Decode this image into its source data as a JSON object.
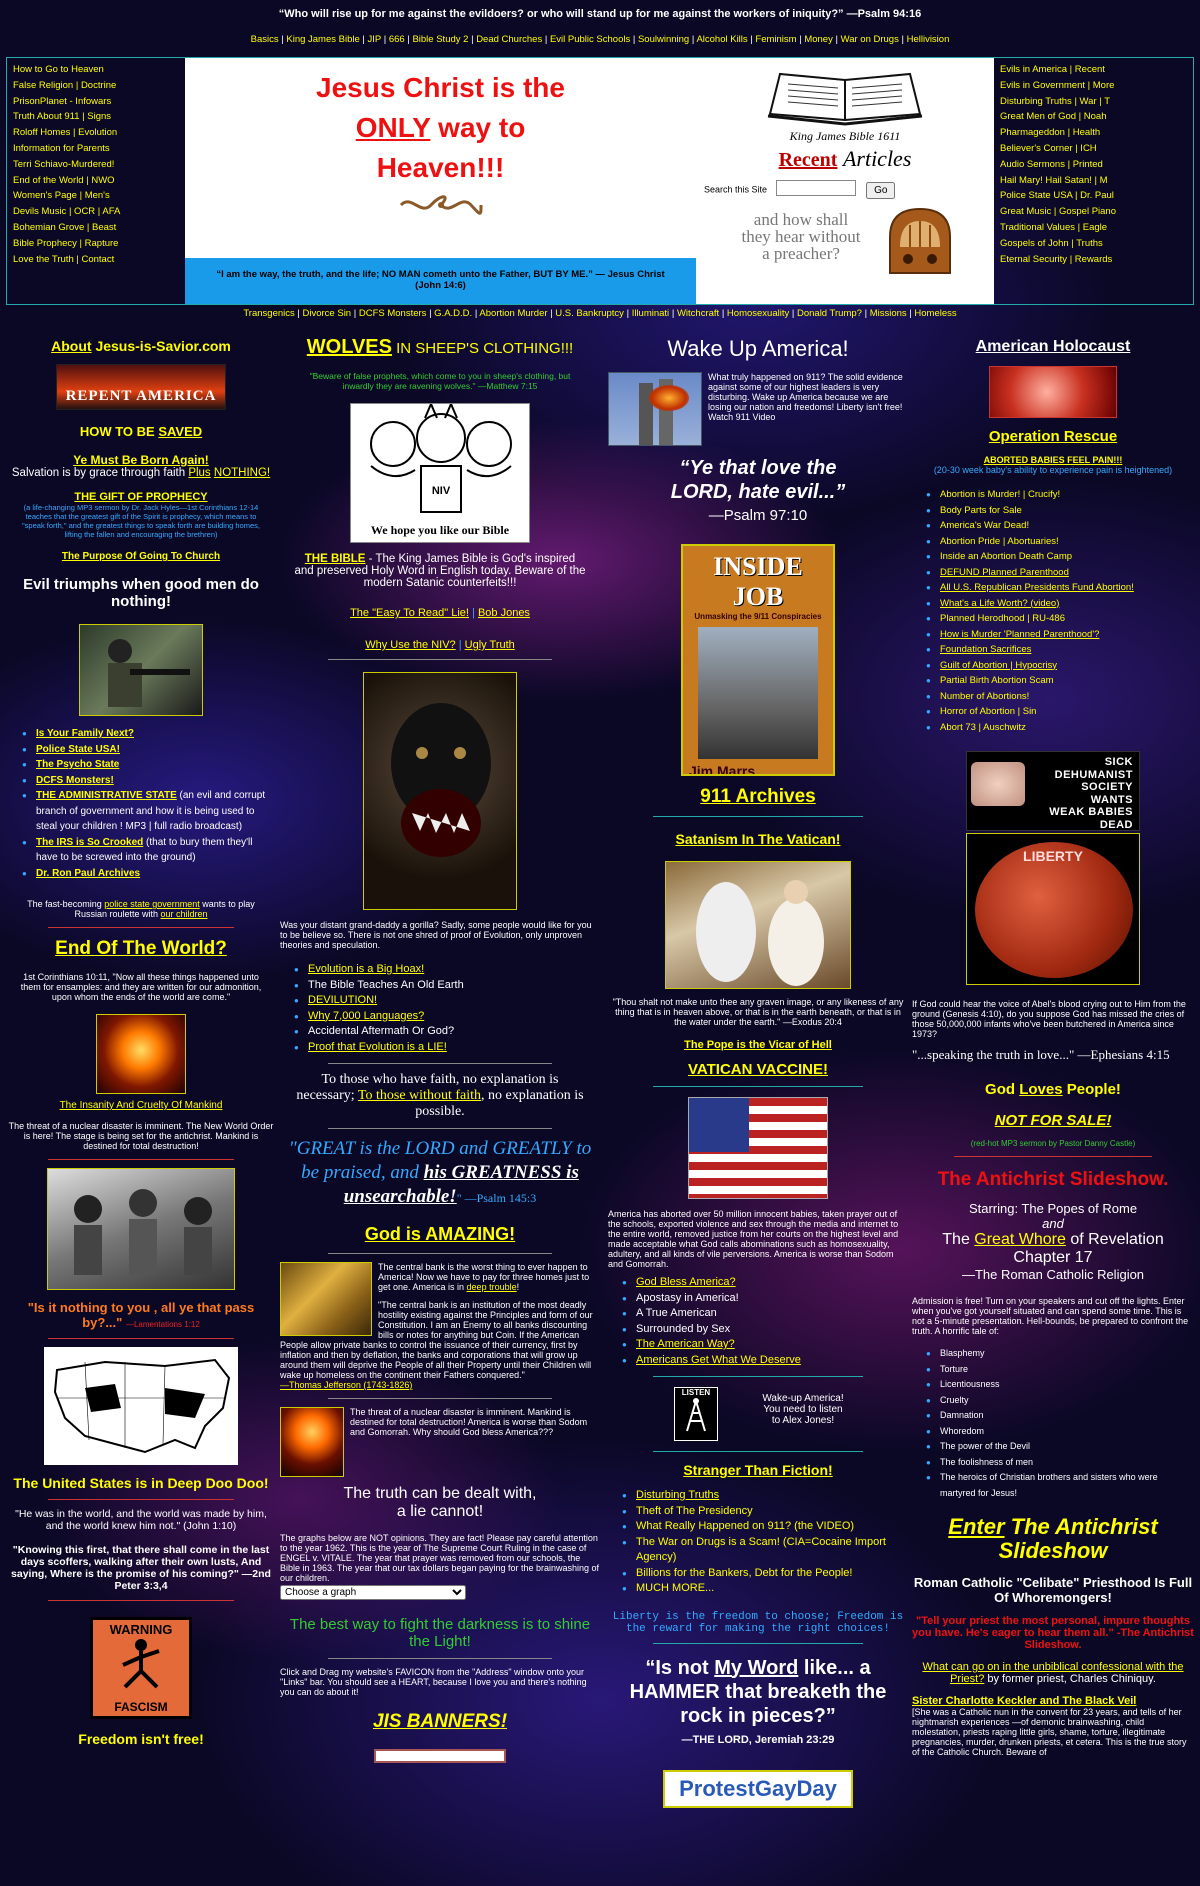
{
  "top": {
    "quote": "“Who will rise up for me against the evildoers? or who will stand up for me against the workers of iniquity?” —Psalm 94:16",
    "nav": [
      "Basics",
      "King James Bible",
      "JIP",
      "666",
      "Bible Study 2",
      "Dead Churches",
      "Evil Public Schools",
      "Soulwinning",
      "Alcohol Kills",
      "Feminism",
      "Money",
      "War on Drugs",
      "Hellivision"
    ]
  },
  "left_links": [
    "How to Go to Heaven",
    "False Religion | Doctrine",
    "PrisonPlanet - Infowars",
    "Truth About 911 | Signs",
    "Roloff Homes | Evolution",
    "Information for Parents",
    "Terri Schiavo-Murdered!",
    "End of the World | NWO",
    "Women's Page | Men's",
    "Devils Music | OCR | AFA",
    "Bohemian Grove | Beast",
    "Bible Prophecy | Rapture",
    "Love the Truth | Contact"
  ],
  "hero": {
    "line1": "Jesus Christ is the",
    "line2_u": "ONLY",
    "line2_rest": " way to",
    "line3": "Heaven!!!",
    "foot": "“I am the way, the truth, and the life; NO MAN cometh unto the Father, BUT BY ME.” — Jesus Christ (John 14:6)"
  },
  "kjv": {
    "caption": "King James Bible 1611",
    "recent": "Recent",
    "articles": "Articles",
    "search_label": "Search this Site",
    "go": "Go",
    "preacher1": "and how shall",
    "preacher2": "they hear without",
    "preacher3": "a preacher?"
  },
  "right_links": [
    "Evils in America | Recent",
    "Evils in Government | More",
    "Disturbing Truths | War | T",
    "Great Men of God | Noah",
    "Pharmageddon | Health",
    "Believer's Corner | ICH",
    "Audio Sermons | Printed",
    "Hail Mary! Hail Satan! | M",
    "Police State USA | Dr. Paul",
    "Great Music | Gospel Piano",
    "Traditional Values | Eagle",
    "Gospels of John | Truths",
    "Eternal Security | Rewards"
  ],
  "sub_nav": [
    "Transgenics",
    "Divorce Sin",
    "DCFS Monsters",
    "G.A.D.D.",
    "Abortion Murder",
    "U.S. Bankruptcy",
    "Illuminati",
    "Witchcraft",
    "Homosexuality",
    "Donald Trump?",
    "Missions",
    "Homeless"
  ],
  "col1": {
    "about_a": "About",
    "about_b": " Jesus-is-Savior.com",
    "repent": "REPENT AMERICA",
    "how_saved": "HOW TO BE",
    "saved": "SAVED",
    "born_again": "Ye Must Be Born Again!",
    "salvation": "Salvation is by grace through faith ",
    "plus": "Plus",
    "nothing": "NOTHING!",
    "gift": "THE GIFT OF PROPHECY",
    "gift_sub": "(a life-changing MP3 sermon by Dr. Jack Hyles—1st Corinthians 12-14 teaches that the greatest gift of the Spirit is prophecy, which means to \"speak forth,\" and the greatest things to speak forth are building homes, lifting the fallen and encouraging the brethren)",
    "purpose": "The Purpose Of Going To Church",
    "evil": "Evil triumphs when good men do nothing!",
    "list": [
      {
        "link": "Is Your Family Next?",
        "rest": ""
      },
      {
        "link": "Police State USA!",
        "rest": ""
      },
      {
        "link": "The Psycho State",
        "rest": ""
      },
      {
        "link": "DCFS Monsters!",
        "rest": ""
      },
      {
        "link": "THE ADMINISTRATIVE STATE",
        "rest": " (an evil and corrupt branch of government and how it is being used to steal your children ! MP3 | full radio broadcast)"
      },
      {
        "link": "The IRS is So Crooked",
        "rest": " (that to bury them they'll have to be screwed into the ground)"
      },
      {
        "link": "Dr. Ron Paul Archives",
        "rest": ""
      }
    ],
    "fast1": "The fast-becoming ",
    "fast_link": "police state government",
    "fast2": " wants to play Russian roulette with ",
    "fast_link2": "our children",
    "end_world": "End Of The World?",
    "cor": "1st Corinthians 10:11, \"Now all these things happened unto them for ensamples: and they are written for our admonition, upon whom the ends of the world are come.\"",
    "insanity": "The Insanity And Cruelty Of Mankind",
    "nuclear": "The threat of a nuclear disaster is imminent. The New World Order is here! The stage is being set for the antichrist. Mankind is destined for total destruction!",
    "is_it": "\"Is it nothing to you , all ye that pass by?...\"",
    "lam": "—Lamentations 1:12",
    "us_deep": "The United States is in Deep Doo Doo!",
    "was_world": "\"He was in the world, and the world was made by him, and the world knew him not.\" (John 1:10)",
    "knowing": "\"Knowing this first, that there shall come in the last days scoffers, walking after their own lusts, And saying, Where is the promise of his coming?\" —2nd Peter 3:3,4",
    "warning": "WARNING",
    "fascism": "FASCISM",
    "freedom": "Freedom isn't free!"
  },
  "col2": {
    "wolves": "WOLVES",
    "wolves_rest": " IN SHEEP'S CLOTHING!!!",
    "beware": "\"Beware of false prophets, which come to you in sheep's clothing, but inwardly they are ravening wolves.\" —Matthew 7:15",
    "niv_caption": "We hope you like our Bible",
    "niv_book": "NIV",
    "bible_head": "THE BIBLE",
    "bible_text": " - The King James Bible is God's inspired and preserved Holy Word in English today. Beware of the modern Satanic counterfeits!!!",
    "easy": "The \"Easy To Read\" Lie!",
    "bob": "Bob Jones",
    "why": "Why Use the NIV?",
    "ugly": "Ugly Truth",
    "gorilla": "Was your distant grand-daddy a gorilla? Sadly, some people would like for you to be believe so. There is not one shred of proof of Evolution, only unproven theories and speculation.",
    "evo_list": [
      {
        "t": "Evolution is a Big Hoax!",
        "l": true
      },
      {
        "t": "The Bible Teaches An Old Earth",
        "l": false
      },
      {
        "t": "DEVILUTION!",
        "l": true
      },
      {
        "t": "Why 7,000 Languages?",
        "l": true
      },
      {
        "t": "Accidental Aftermath Or God?",
        "l": false
      },
      {
        "t": "Proof that Evolution is a LIE!",
        "l": true
      }
    ],
    "faith1": "To those who have faith, no explanation is necessary; ",
    "faith_link": "To those without faith",
    "faith2": ", no explanation is possible.",
    "great1": "\"GREAT is the LORD and GREATLY to be praised, and ",
    "great_u": "his GREATNESS is unsearchable!",
    "great2": "\" —Psalm 145:3",
    "amazing": "God is AMAZING!",
    "bank1": "The central bank is the worst thing to ever happen to America! Now we have to pay for three homes just to get one. America is in ",
    "bank_link": "deep trouble",
    "bank2": "!",
    "jeff": "\"The central bank is an institution of the most deadly hostility existing against the Principles and form of our Constitution. I am an Enemy to all banks discounting bills or notes for anything but Coin. If the American People allow private banks to control the issuance of their currency, first by inflation and then by deflation, the banks and corporations that will grow up around them will deprive the People of all their Property until their Children will wake up homeless on the continent their Fathers conquered.\"",
    "jeff_by": "—Thomas Jefferson (1743-1826)",
    "nuke": "The threat of a nuclear disaster is imminent. Mankind is destined for total destruction! America is worse than Sodom and Gomorrah. Why should God bless America???",
    "truth1": "The truth can be dealt with,",
    "truth2": "a lie cannot!",
    "graphs": "The graphs below are NOT opinions. They are fact! Please pay careful attention to the year 1962. This is the year of The Supreme Court Ruling in the case of ENGEL v. VITALE. The year that prayer was removed from our schools, the Bible in 1963. The year that our tax dollars began paying for the brainwashing of our children.",
    "select": "Choose a graph",
    "best_way": "The best way to fight the darkness is to shine the Light!",
    "favicon": "Click and Drag my website's FAVICON from the \"Address\" window onto your \"Links\" bar. You should see a HEART, because I love you and there's nothing you can do about it!",
    "banners": "JIS BANNERS!"
  },
  "col3": {
    "wake": "Wake Up America!",
    "what": "What truly happened on 911? The solid evidence against some of our highest leaders is very disturbing. Wake up America because we are losing our nation and freedoms! Liberty isn't free! Watch 911 Video",
    "love1": "“Ye that love the",
    "love2": "LORD, hate evil...”",
    "love3": "—Psalm 97:10",
    "inside": "INSIDE JOB",
    "inside_sub": "Unmasking the 9/11 Conspiracies",
    "marrs": "Jim Marrs",
    "archives": "911 Archives",
    "satanism": "Satanism In The Vatican!",
    "thou": "\"Thou shalt not make unto thee any graven image, or any likeness of any thing that is in heaven above, or that is in the earth beneath, or that is in the water under the earth.\" —Exodus 20:4",
    "pope": "The Pope is the Vicar of Hell",
    "vaccine": "VATICAN VACCINE!",
    "america": "America has aborted over 50 million innocent babies, taken prayer out of the schools, exported violence and sex through the media and internet to the entire world, removed justice from her courts on the highest level and made acceptable what God calls abominations such as homosexuality, adultery, and all kinds of vile perversions. America is worse than Sodom and Gomorrah.",
    "list": [
      {
        "t": "God Bless America?",
        "l": true
      },
      {
        "t": "Apostasy in America!",
        "l": false
      },
      {
        "t": "A True American",
        "l": false
      },
      {
        "t": "Surrounded by Sex",
        "l": false
      },
      {
        "t": "The American Way?",
        "l": true
      },
      {
        "t": "Americans Get What We Deserve",
        "l": true
      }
    ],
    "listen": "LISTEN",
    "alex": "Wake-up America! You need to listen to Alex Jones!",
    "stranger": "Stranger Than Fiction!",
    "list2": [
      {
        "t": "Disturbing Truths",
        "l": true
      },
      {
        "t": "Theft of The Presidency",
        "l": false
      },
      {
        "t": "What Really Happened on 911? (the VIDEO)",
        "l": false
      },
      {
        "t": "The War on Drugs is a Scam! (CIA=Cocaine Import Agency)",
        "l": false
      },
      {
        "t": "Billions for the Bankers, Debt for the People!",
        "l": false
      },
      {
        "t": "MUCH MORE...",
        "l": false
      }
    ],
    "liberty": "Liberty is the freedom to choose; Freedom is the reward for making the right choices!",
    "word1": "“Is not ",
    "word_u": "My Word",
    "word2": " like... a HAMMER that breaketh the rock in pieces?”",
    "word_by": "—THE LORD, Jeremiah 23:29",
    "protest": "ProtestGayDay"
  },
  "col4": {
    "holocaust": "American Holocaust",
    "rescue": "Operation Rescue",
    "aborted": "ABORTED BABIES FEEL PAIN!!!",
    "weeks": "(20-30 week baby's ability to experience pain is heightened)",
    "list": [
      {
        "t": "Abortion is Murder! | Crucify!",
        "l": false
      },
      {
        "t": "Body Parts for Sale",
        "l": false
      },
      {
        "t": "America's War Dead!",
        "l": false
      },
      {
        "t": "Abortion Pride | Abortuaries!",
        "l": false
      },
      {
        "t": "Inside an Abortion Death Camp",
        "l": false
      },
      {
        "t": "DEFUND Planned Parenthood",
        "l": true
      },
      {
        "t": "All U.S. Republican Presidents Fund Abortion!",
        "l": true
      },
      {
        "t": "What's a Life Worth? (video)",
        "l": true
      },
      {
        "t": "Planned Herodhood | RU-486",
        "l": false
      },
      {
        "t": "How is Murder 'Planned Parenthood'?",
        "l": true
      },
      {
        "t": "Foundation Sacrifices",
        "l": true
      },
      {
        "t": "Guilt of Abortion | Hypocrisy",
        "l": true
      },
      {
        "t": "Partial Birth Abortion Scam",
        "l": false
      },
      {
        "t": "Number of Abortions!",
        "l": false
      },
      {
        "t": "Horror of Abortion | Sin",
        "l": false
      },
      {
        "t": "Abort 73 | Auschwitz",
        "l": false
      }
    ],
    "sick": [
      "SICK",
      "DEHUMANIST",
      "SOCIETY",
      "WANTS",
      "WEAK BABIES",
      "DEAD"
    ],
    "liberty": "LIBERTY",
    "if_god": "If God could hear the voice of Abel's blood crying out to Him from the ground (Genesis 4:10), do you suppose God has missed the cries of those 50,000,000 infants who've been butchered in America since 1973?",
    "speaking": "\"...speaking the truth in love...\" —Ephesians 4:15",
    "god_loves1": "God ",
    "god_loves_u": "Loves",
    "god_loves2": " People!",
    "not_sale": "NOT FOR SALE!",
    "redhot": "(red-hot MP3 sermon by Pastor Danny Castle)",
    "slideshow": "The Antichrist Slideshow.",
    "starring": "Starring: The Popes of Rome",
    "and": "and",
    "whore1": "The ",
    "whore_link": "Great Whore",
    "whore2": " of Revelation Chapter 17",
    "rcr": "—The Roman Catholic Religion",
    "admission": "Admission is free! Turn on your speakers and cut off the lights. Enter when you've got yourself situated and can spend some time. This is not a 5-minute presentation. Hell-bounds, be prepared to confront the truth. A horrific tale of:",
    "tale": [
      "Blasphemy",
      "Torture",
      "Licentiousness",
      "Cruelty",
      "Damnation",
      "Whoredom",
      "The power of the Devil",
      "The foolishness of men",
      "The heroics of Christian brothers and sisters who were martyred for Jesus!"
    ],
    "enter_u": "Enter",
    "enter_rest": " The Antichrist Slideshow",
    "celibate": "Roman Catholic \"Celibate\" Priesthood Is Full Of Whoremongers!",
    "tell": "\"Tell your priest the most personal, impure thoughts you have. He's eager to hear them all.\" -The Antichrist Slideshow.",
    "confess": "What can go on in the unbiblical confessional with the Priest?",
    "confess_by": " by former priest, Charles Chiniquy.",
    "keckler": "Sister Charlotte Keckler and The Black Veil",
    "keckler_txt": "[She was a Catholic nun in the convent for 23 years, and tells of her nightmarish experiences —of demonic brainwashing, child molestation, priests raping little girls, shame, torture, illegitimate pregnancies, murder, drunken priests, et cetera. This is the true story of the Catholic Church. Beware of"
  }
}
